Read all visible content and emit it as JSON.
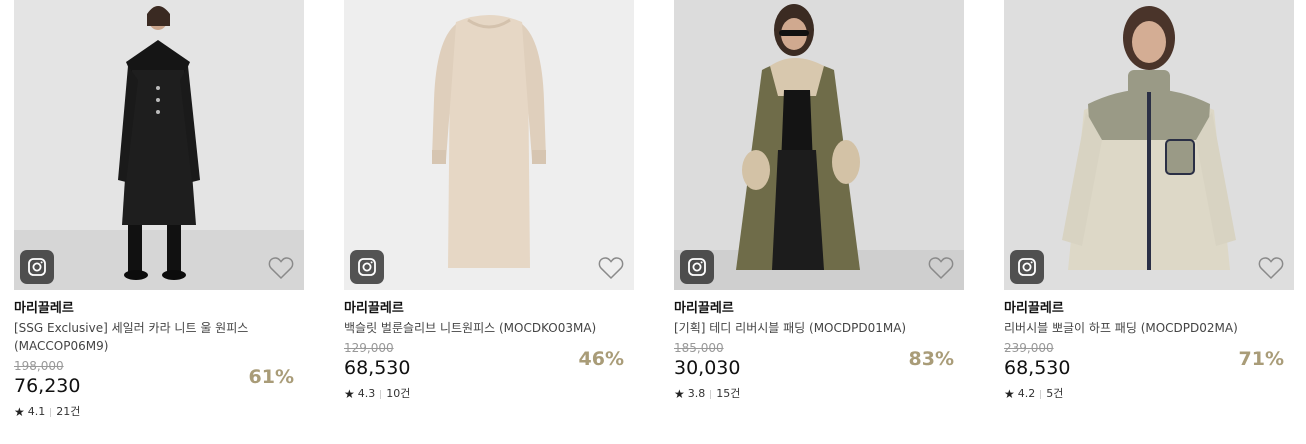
{
  "products": [
    {
      "brand": "마리끌레르",
      "title": "[SSG Exclusive] 세일러 카라 니트 울 원피스 (MACCOP06M9)",
      "original_price": "198,000",
      "price": "76,230",
      "discount": "61%",
      "rating": "4.1",
      "reviews": "21건",
      "bg_color": "#e3e3e3",
      "garment_color": "#1e1e1e"
    },
    {
      "brand": "마리끌레르",
      "title": "백슬릿 벌룬슬리브 니트원피스 (MOCDKO03MA)",
      "original_price": "129,000",
      "price": "68,530",
      "discount": "46%",
      "rating": "4.3",
      "reviews": "10건",
      "bg_color": "#ededed",
      "garment_color": "#e6d7c5"
    },
    {
      "brand": "마리끌레르",
      "title": "[기획] 테디 리버시블 패딩 (MOCDPD01MA)",
      "original_price": "185,000",
      "price": "30,030",
      "discount": "83%",
      "rating": "3.8",
      "reviews": "15건",
      "bg_color": "#dcdcdc",
      "garment_color": "#6f6c49"
    },
    {
      "brand": "마리끌레르",
      "title": "리버시블 뽀글이 하프 패딩 (MOCDPD02MA)",
      "original_price": "239,000",
      "price": "68,530",
      "discount": "71%",
      "rating": "4.2",
      "reviews": "5건",
      "bg_color": "#dedede",
      "garment_color": "#ddd8c7"
    }
  ],
  "icons": {
    "photo_badge": "instagram-icon",
    "wishlist": "heart-outline-icon",
    "rating": "star-icon"
  },
  "colors": {
    "discount": "#a99c78",
    "strike_price": "#999999"
  }
}
